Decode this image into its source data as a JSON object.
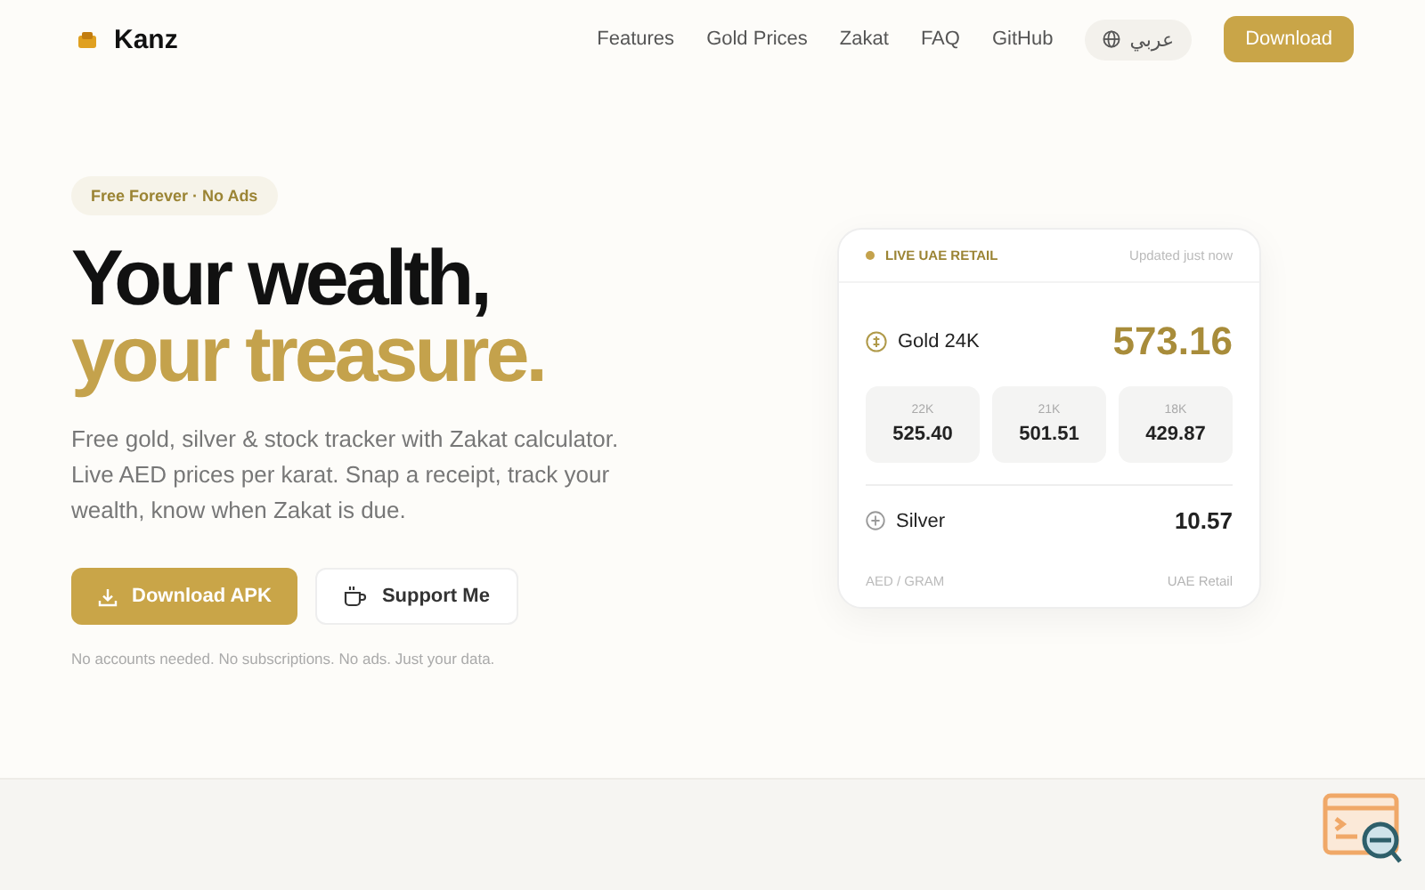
{
  "brand": {
    "name": "Kanz"
  },
  "nav": {
    "links": [
      "Features",
      "Gold Prices",
      "Zakat",
      "FAQ",
      "GitHub"
    ],
    "language": "عربي",
    "download": "Download"
  },
  "hero": {
    "badge": "Free Forever · No Ads",
    "title_line1": "Your wealth,",
    "title_line2": "your treasure.",
    "description": "Free gold, silver & stock tracker with Zakat calculator. Live AED prices per karat. Snap a receipt, track your wealth, know when Zakat is due.",
    "primary_button": "Download APK",
    "secondary_button": "Support Me",
    "footnote": "No accounts needed. No subscriptions. No ads. Just your data."
  },
  "price_card": {
    "live_label": "LIVE UAE RETAIL",
    "updated": "Updated just now",
    "main": {
      "name": "Gold 24K",
      "price": "573.16"
    },
    "karats": [
      {
        "label": "22K",
        "price": "525.40"
      },
      {
        "label": "21K",
        "price": "501.51"
      },
      {
        "label": "18K",
        "price": "429.87"
      }
    ],
    "silver": {
      "name": "Silver",
      "price": "10.57"
    },
    "unit": "AED / GRAM",
    "source": "UAE Retail"
  }
}
